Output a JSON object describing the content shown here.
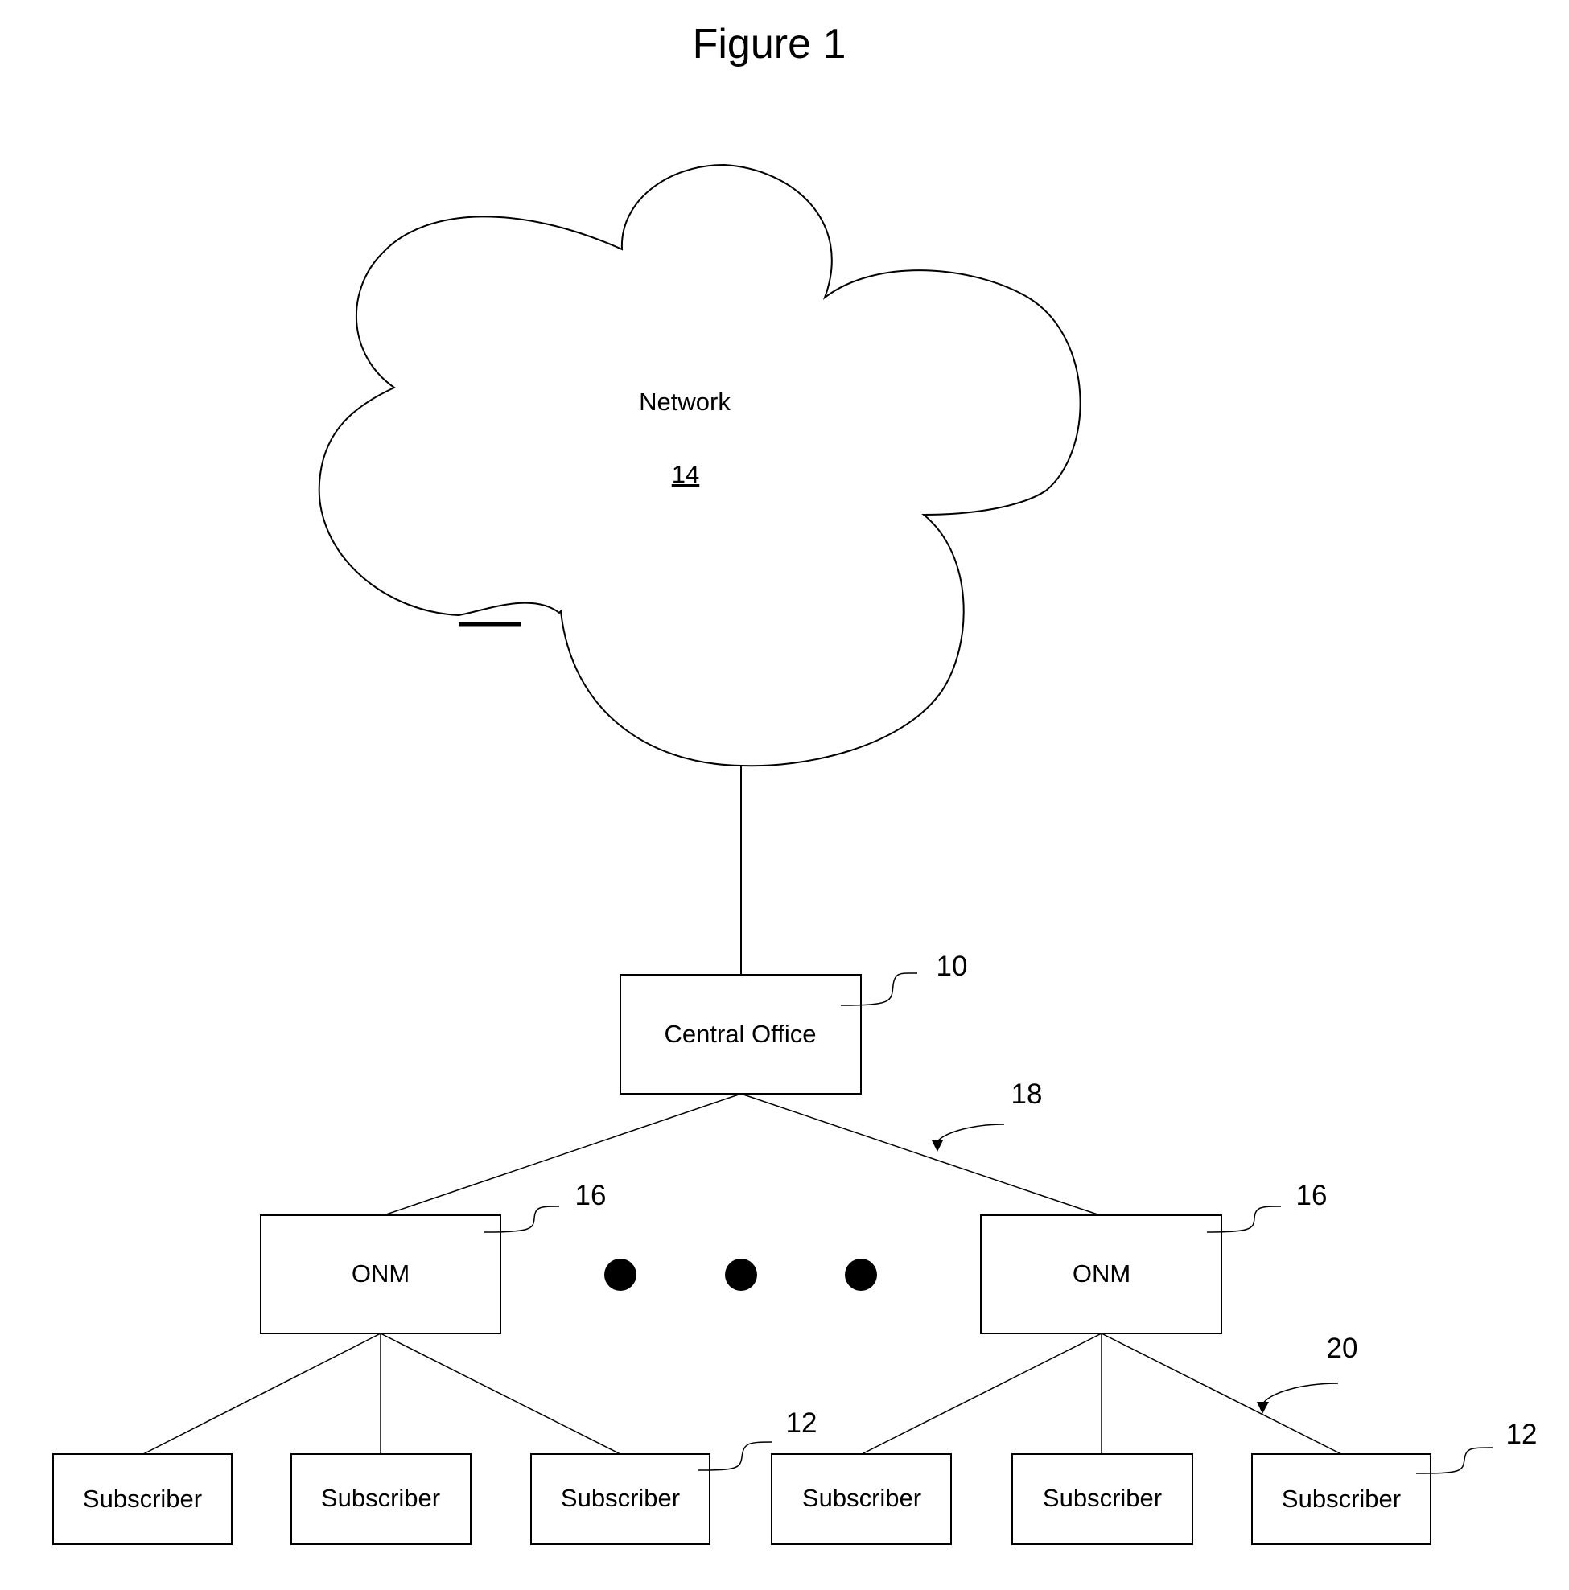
{
  "title": "Figure 1",
  "network": {
    "label": "Network",
    "ref": "14"
  },
  "central_office": {
    "label": "Central Office",
    "ref": "10"
  },
  "link_ref_upper": "18",
  "link_ref_lower": "20",
  "onm": [
    {
      "label": "ONM",
      "ref": "16"
    },
    {
      "label": "ONM",
      "ref": "16"
    }
  ],
  "ellipsis_dots": 3,
  "subscribers": [
    {
      "label": "Subscriber"
    },
    {
      "label": "Subscriber"
    },
    {
      "label": "Subscriber",
      "ref": "12"
    },
    {
      "label": "Subscriber"
    },
    {
      "label": "Subscriber"
    },
    {
      "label": "Subscriber",
      "ref": "12"
    }
  ]
}
